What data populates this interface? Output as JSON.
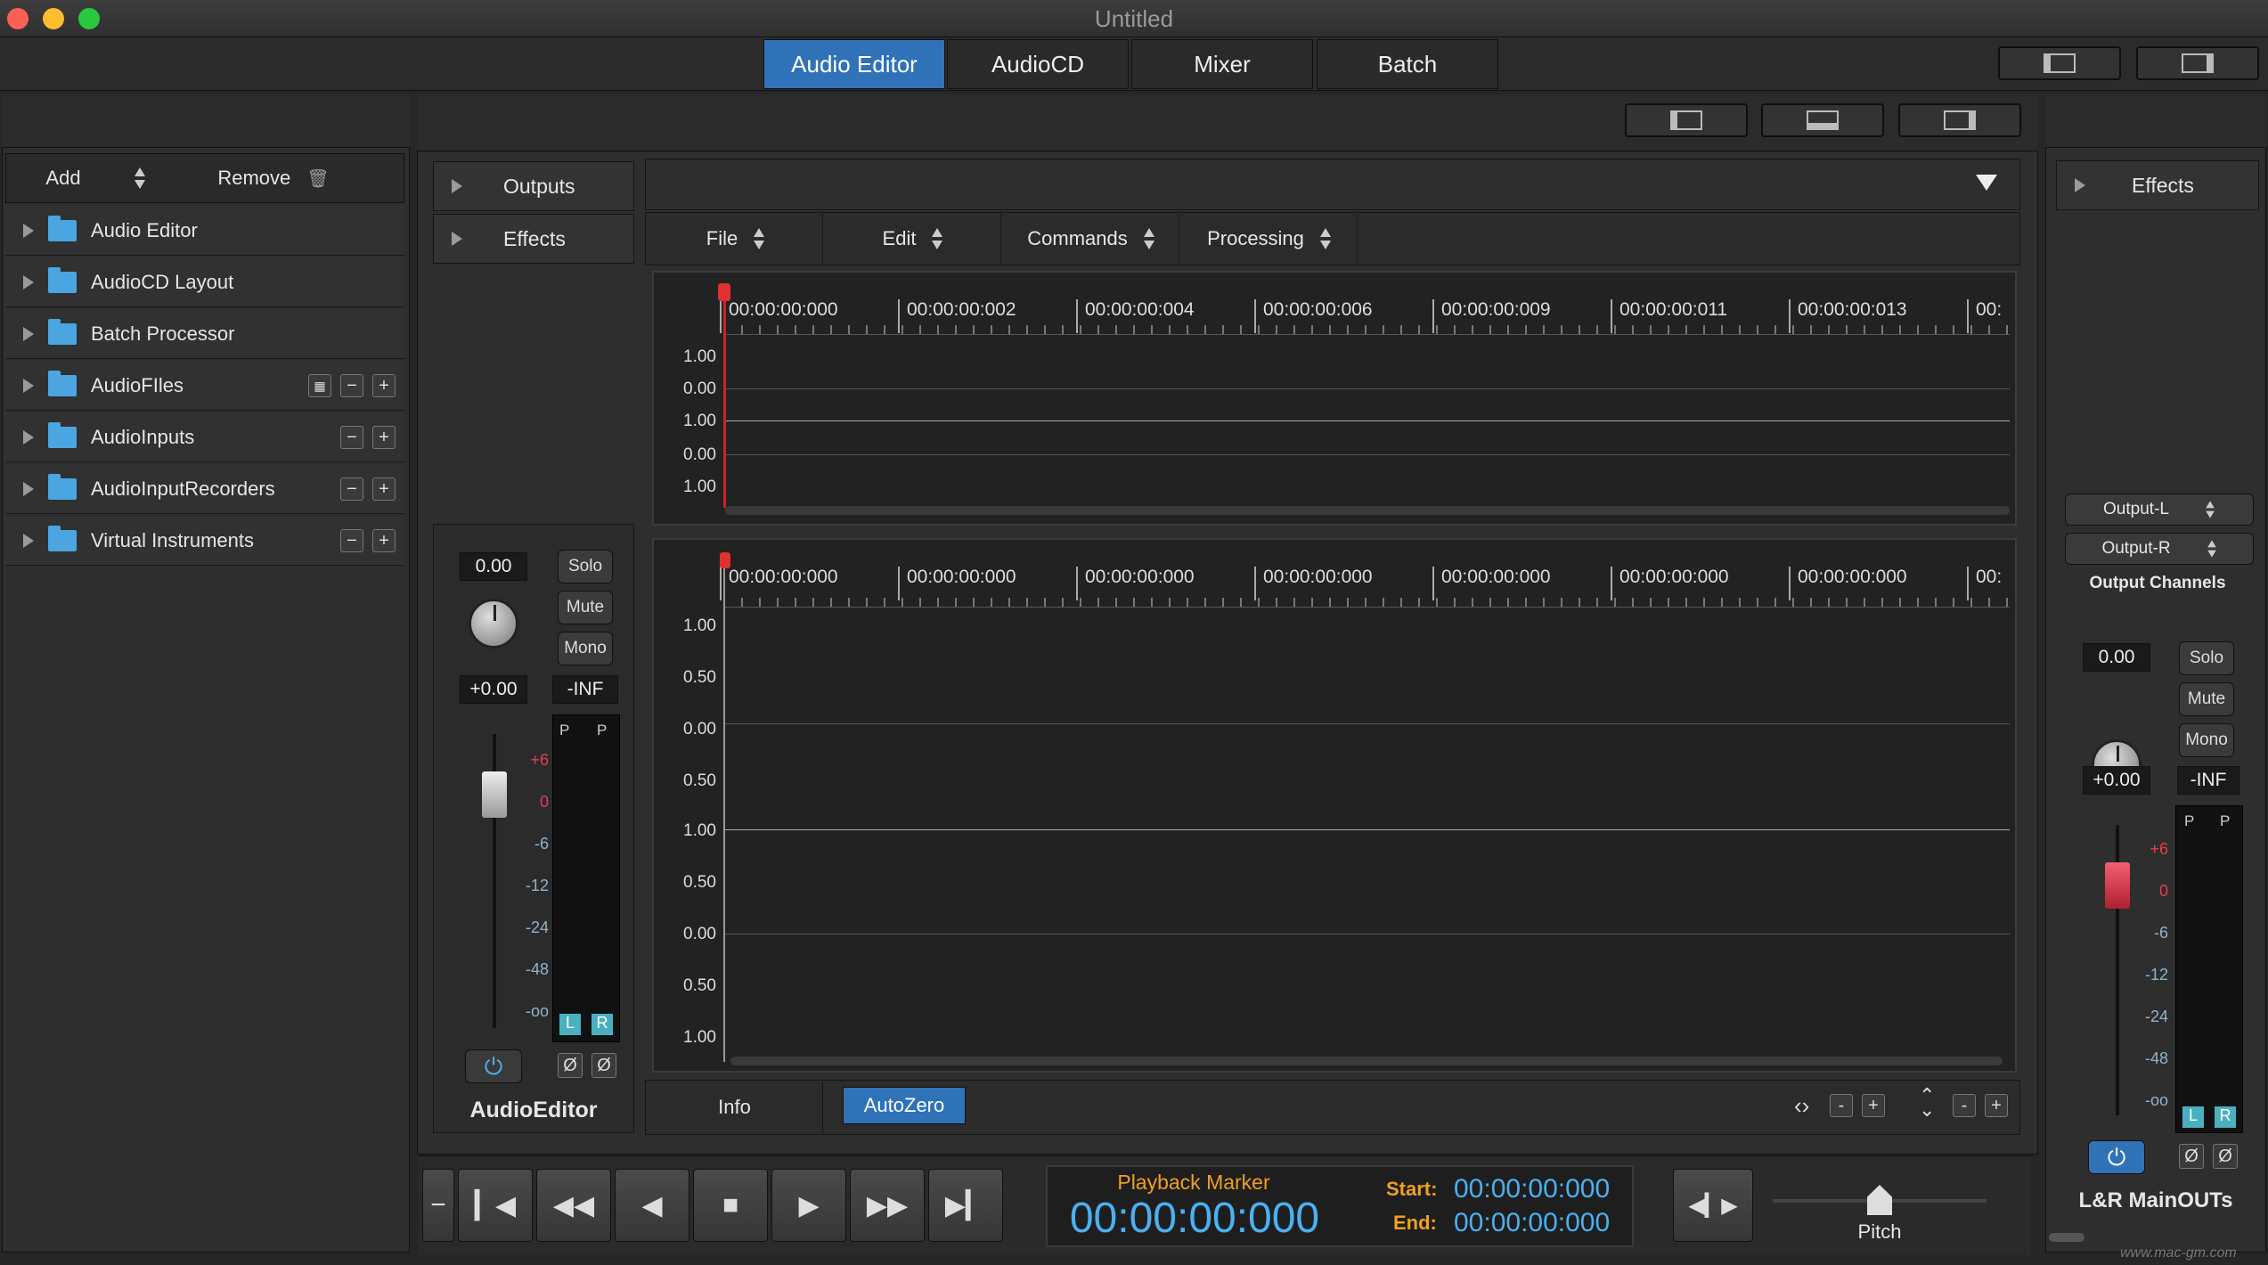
{
  "window": {
    "title": "Untitled"
  },
  "tabs": [
    "Audio Editor",
    "AudioCD",
    "Mixer",
    "Batch"
  ],
  "left": {
    "add_label": "Add",
    "remove_label": "Remove",
    "items": [
      "Audio Editor",
      "AudioCD Layout",
      "Batch Processor",
      "AudioFIles",
      "AudioInputs",
      "AudioInputRecorders",
      "Virtual Instruments"
    ]
  },
  "inspector": {
    "outputs_label": "Outputs",
    "effects_label": "Effects"
  },
  "channel_left": {
    "gain": "0.00",
    "solo": "Solo",
    "mute": "Mute",
    "mono": "Mono",
    "pan": "+0.00",
    "peak": "-INF",
    "p1": "P",
    "p2": "P",
    "l": "L",
    "r": "R",
    "phase1": "Ø",
    "phase2": "Ø",
    "scale": [
      "+6",
      "0",
      "-6",
      "-12",
      "-24",
      "-48",
      "-oo"
    ],
    "name": "AudioEditor"
  },
  "editor": {
    "menus": [
      "File",
      "Edit",
      "Commands",
      "Processing"
    ],
    "ruler_top": [
      "00:00:00:000",
      "00:00:00:002",
      "00:00:00:004",
      "00:00:00:006",
      "00:00:00:009",
      "00:00:00:011",
      "00:00:00:013",
      "00:"
    ],
    "ruler_bottom": [
      "00:00:00:000",
      "00:00:00:000",
      "00:00:00:000",
      "00:00:00:000",
      "00:00:00:000",
      "00:00:00:000",
      "00:00:00:000",
      "00:"
    ],
    "y_top": [
      "1.00",
      "0.00",
      "1.00",
      "0.00",
      "1.00"
    ],
    "y_bottom": [
      "1.00",
      "0.50",
      "0.00",
      "0.50",
      "1.00",
      "0.50",
      "0.00",
      "0.50",
      "1.00"
    ],
    "info_label": "Info",
    "autozero_label": "AutoZero",
    "minus": "-",
    "plus": "+"
  },
  "right": {
    "effects_label": "Effects",
    "output_l": "Output-L",
    "output_r": "Output-R",
    "output_channels": "Output Channels",
    "gain": "0.00",
    "solo": "Solo",
    "mute": "Mute",
    "mono": "Mono",
    "pan": "+0.00",
    "peak": "-INF",
    "p1": "P",
    "p2": "P",
    "l": "L",
    "r": "R",
    "phase1": "Ø",
    "phase2": "Ø",
    "scale": [
      "+6",
      "0",
      "-6",
      "-12",
      "-24",
      "-48",
      "-oo"
    ],
    "name": "L&R MainOUTs"
  },
  "transport": {
    "marker_label": "Playback Marker",
    "marker_time": "00:00:00:000",
    "start_label": "Start:",
    "start_time": "00:00:00:000",
    "end_label": "End:",
    "end_time": "00:00:00:000",
    "pitch_label": "Pitch"
  },
  "watermark": "www.mac-gm.com",
  "colors": {
    "accent": "#2f72b8",
    "marker_orange": "#f0a020",
    "time_blue": "#4ab0f0",
    "fader_red": "#e0404a"
  }
}
